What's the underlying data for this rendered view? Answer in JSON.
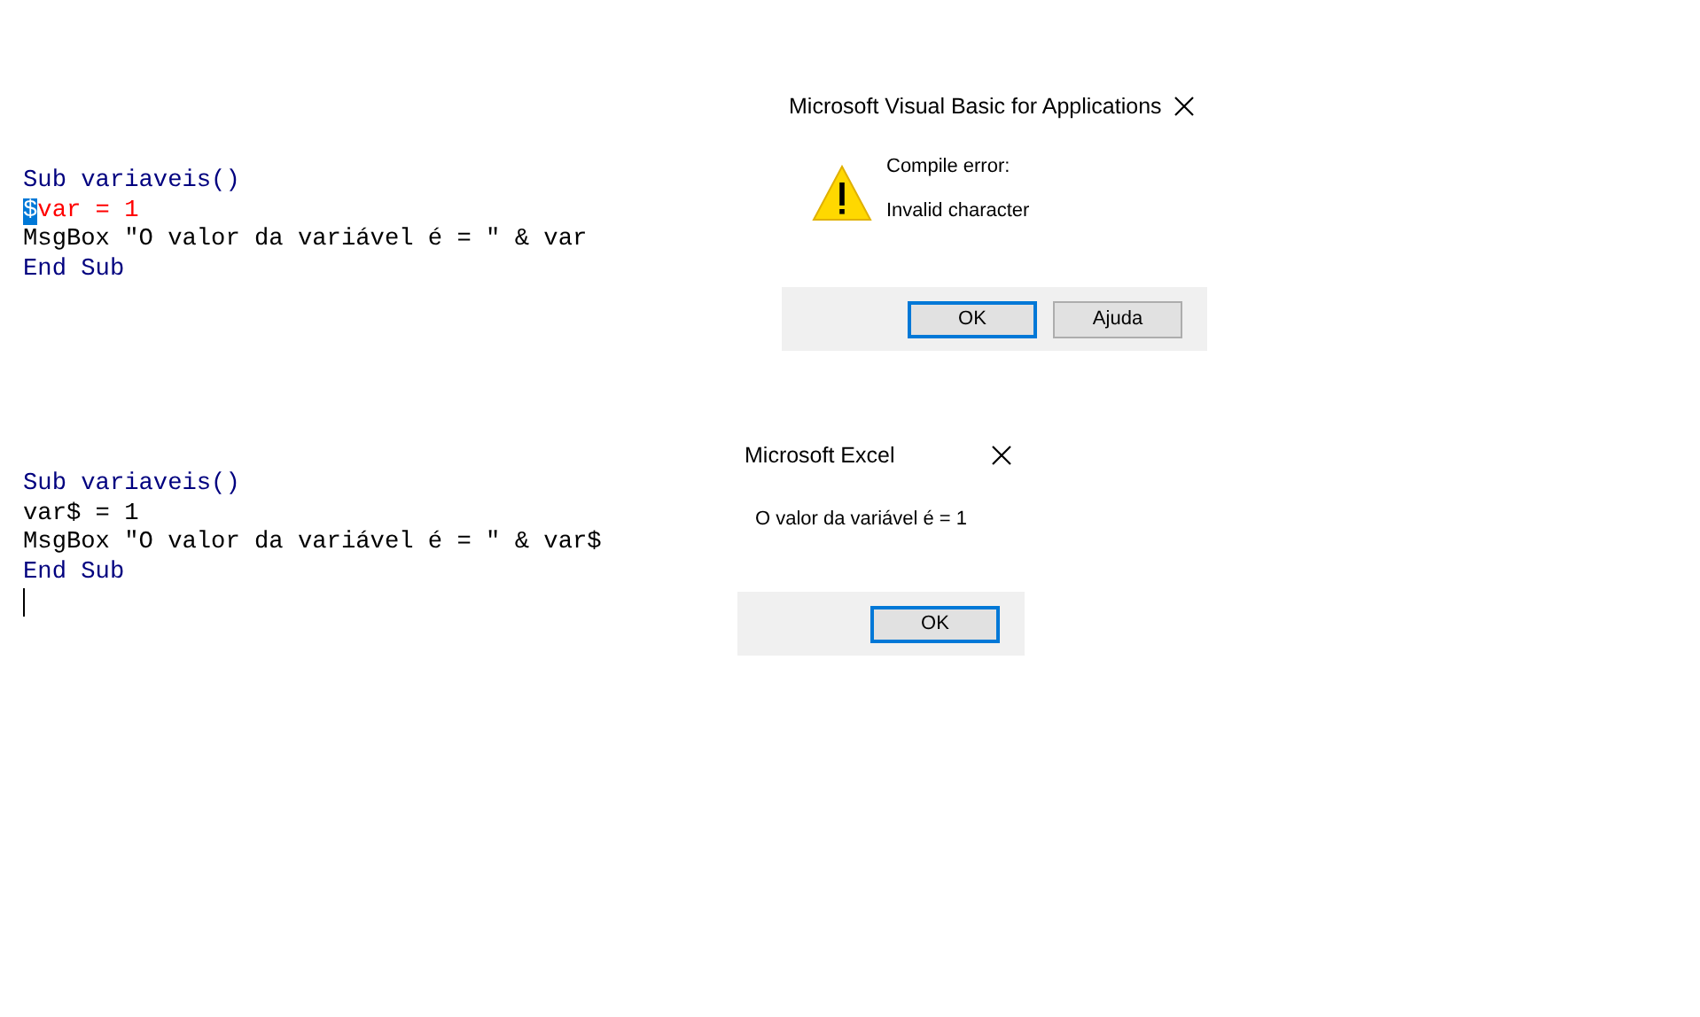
{
  "code_blocks": [
    {
      "lines": [
        {
          "kind": "keyword",
          "tokens": [
            {
              "text": "Sub variaveis()",
              "selected": false
            }
          ]
        },
        {
          "kind": "error",
          "tokens": [
            {
              "text": "$",
              "selected": true
            },
            {
              "text": "var = 1",
              "selected": false
            }
          ]
        },
        {
          "kind": "plain",
          "tokens": [
            {
              "text": "MsgBox \"O valor da variável é = \" & var",
              "selected": false
            }
          ]
        },
        {
          "kind": "keyword",
          "tokens": [
            {
              "text": "End Sub",
              "selected": false
            }
          ]
        }
      ]
    },
    {
      "lines": [
        {
          "kind": "keyword",
          "tokens": [
            {
              "text": "Sub variaveis()",
              "selected": false
            }
          ]
        },
        {
          "kind": "plain",
          "tokens": [
            {
              "text": "var$ = 1",
              "selected": false
            }
          ]
        },
        {
          "kind": "plain",
          "tokens": [
            {
              "text": "MsgBox \"O valor da variável é = \" & var$",
              "selected": false
            }
          ]
        },
        {
          "kind": "keyword",
          "tokens": [
            {
              "text": "End Sub",
              "selected": false
            }
          ]
        }
      ],
      "caret": true
    }
  ],
  "dialogs": [
    {
      "title": "Microsoft Visual Basic for Applications",
      "kind": "warning",
      "messages": [
        "Compile error:",
        "Invalid character"
      ],
      "buttons": [
        {
          "label": "OK",
          "selected": true
        },
        {
          "label": "Ajuda",
          "selected": false
        }
      ]
    },
    {
      "title": "Microsoft Excel",
      "kind": "plain",
      "messages": [
        "O valor da variável é = 1"
      ],
      "buttons": [
        {
          "label": "OK",
          "selected": true
        }
      ]
    }
  ]
}
